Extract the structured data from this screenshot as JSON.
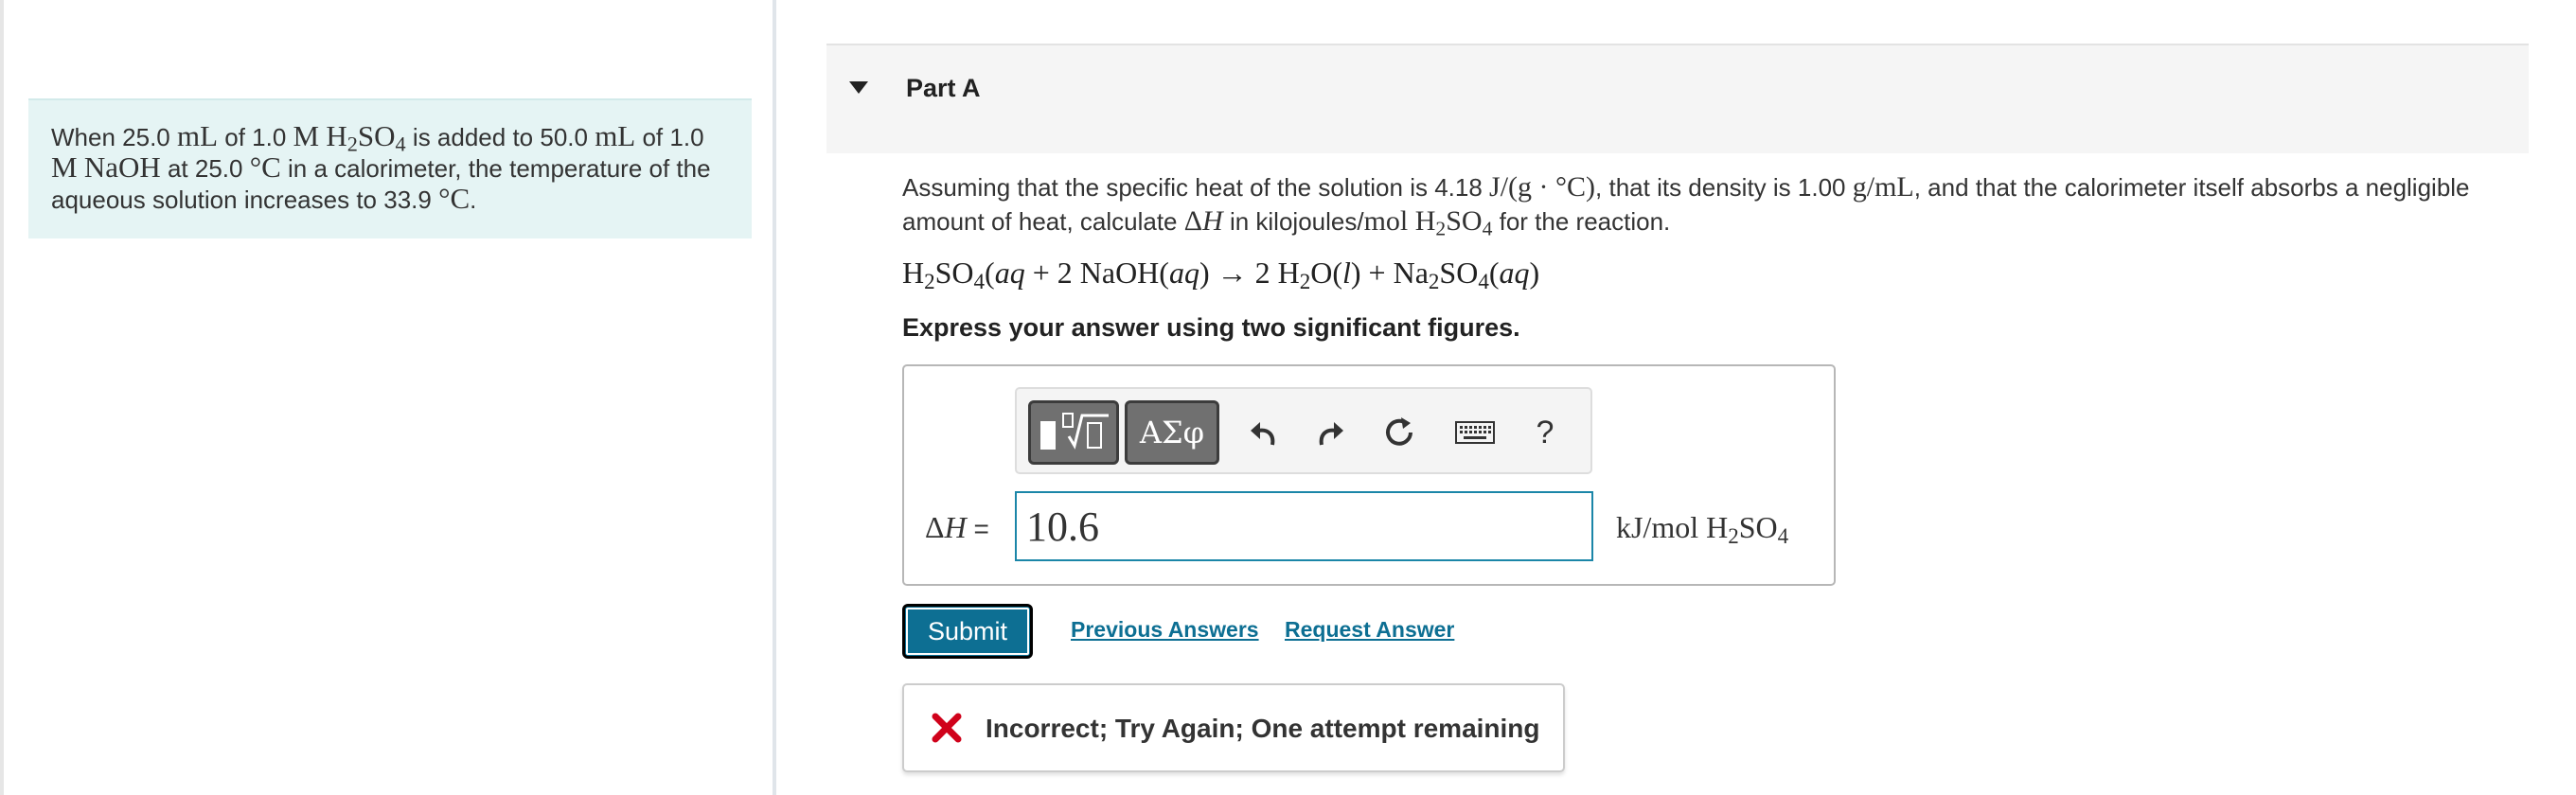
{
  "intro": {
    "line1_a": "When 25.0 ",
    "unit_mL": "mL",
    "line1_b": " of 1.0 ",
    "M": "M",
    "H2SO4_H": "H",
    "H2SO4_2": "2",
    "H2SO4_SO": "SO",
    "H2SO4_4": "4",
    "line1_c": " is added to 50.0 ",
    "unit_mL2": "mL",
    "line1_d": " of 1.0",
    "M2": "M",
    "NaOH": "NaOH",
    "line2_a": " at 25.0 ",
    "degC": "°C",
    "line2_b": " in a calorimeter, the temperature of the aqueous solution increases to 33.9 ",
    "degC2": "°C",
    "end": "."
  },
  "part": {
    "title": "Part A"
  },
  "question": {
    "t1": "Assuming that the specific heat of the solution is 4.18 ",
    "specific_heat_unit": "J/(g · °C)",
    "t2": ", that its density is 1.00 ",
    "density_unit": "g/mL",
    "t3": ", and that the calorimeter itself absorbs a negligible amount of heat, calculate ",
    "delta": "Δ",
    "H": "H",
    "t4": " in kilojoules/",
    "mol": "mol",
    "t5": " for the reaction."
  },
  "equation": {
    "lhs1": "H",
    "lhs1b": "SO",
    "aq": "aq",
    "plus": " + 2 NaOH(",
    "arrow": ") → 2 H",
    "h2o": "O(",
    "l": "l",
    "plus2": ") + Na",
    "so4": "SO",
    "two": "2",
    "four": "4"
  },
  "instruction": "Express your answer using two significant figures.",
  "toolbar": {
    "symbols_label": "ΑΣφ",
    "help_label": "?",
    "icons": [
      "templates-icon",
      "undo-icon",
      "redo-icon",
      "reset-icon",
      "keyboard-icon",
      "help-icon"
    ]
  },
  "answer": {
    "label_delta": "Δ",
    "label_H": "H",
    "label_eq": " =",
    "value": "10.6",
    "unit_prefix": "kJ/mol H",
    "unit_mid": "SO"
  },
  "actions": {
    "submit_label": "Submit",
    "previous_answers_label": "Previous Answers",
    "request_answer_label": "Request Answer"
  },
  "feedback": {
    "text": "Incorrect; Try Again; One attempt remaining"
  },
  "colors": {
    "accent": "#0d6f93",
    "intro_bg": "#e5f4f4",
    "error_red": "#d0021b"
  }
}
